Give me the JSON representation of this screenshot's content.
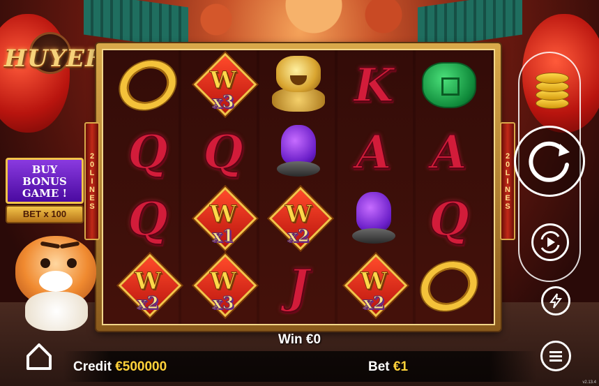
{
  "logo": {
    "text": "HUYEH"
  },
  "paylines": {
    "left": [
      "2",
      "0",
      "L",
      "I",
      "N",
      "E",
      "S"
    ],
    "right": [
      "2",
      "0",
      "L",
      "I",
      "N",
      "E",
      "S"
    ]
  },
  "buy_bonus": {
    "line1": "BUY",
    "line2": "BONUS",
    "line3": "GAME !",
    "cost": "BET x 100"
  },
  "reels": [
    [
      {
        "type": "ring"
      },
      {
        "type": "letter",
        "label": "Q"
      },
      {
        "type": "letter",
        "label": "Q"
      },
      {
        "type": "wild",
        "label": "W",
        "mult": "x2"
      }
    ],
    [
      {
        "type": "wild",
        "label": "W",
        "mult": "x3"
      },
      {
        "type": "letter",
        "label": "Q"
      },
      {
        "type": "wild",
        "label": "W",
        "mult": "x1"
      },
      {
        "type": "wild",
        "label": "W",
        "mult": "x3"
      }
    ],
    [
      {
        "type": "foo"
      },
      {
        "type": "gem"
      },
      {
        "type": "wild",
        "label": "W",
        "mult": "x2"
      },
      {
        "type": "letter",
        "label": "J"
      }
    ],
    [
      {
        "type": "letter",
        "label": "K"
      },
      {
        "type": "letter",
        "label": "A"
      },
      {
        "type": "gem"
      },
      {
        "type": "wild",
        "label": "W",
        "mult": "x2"
      }
    ],
    [
      {
        "type": "jade"
      },
      {
        "type": "letter",
        "label": "A"
      },
      {
        "type": "letter",
        "label": "Q"
      },
      {
        "type": "ring"
      }
    ]
  ],
  "status": {
    "win_label": "Win €0",
    "credit_label": "Credit",
    "credit_value": "€500000",
    "bet_label": "Bet",
    "bet_value": "€1"
  },
  "version": "v2.13.4",
  "colors": {
    "accent": "#ffd23a",
    "frame": "#d9a94a",
    "letter": "#d21c3a",
    "bonus": "#6a1ec8"
  },
  "icons": {
    "coins": "coins-icon",
    "spin": "spin-icon",
    "autoplay": "autoplay-icon",
    "turbo": "lightning-icon",
    "home": "home-icon",
    "menu": "menu-icon"
  }
}
